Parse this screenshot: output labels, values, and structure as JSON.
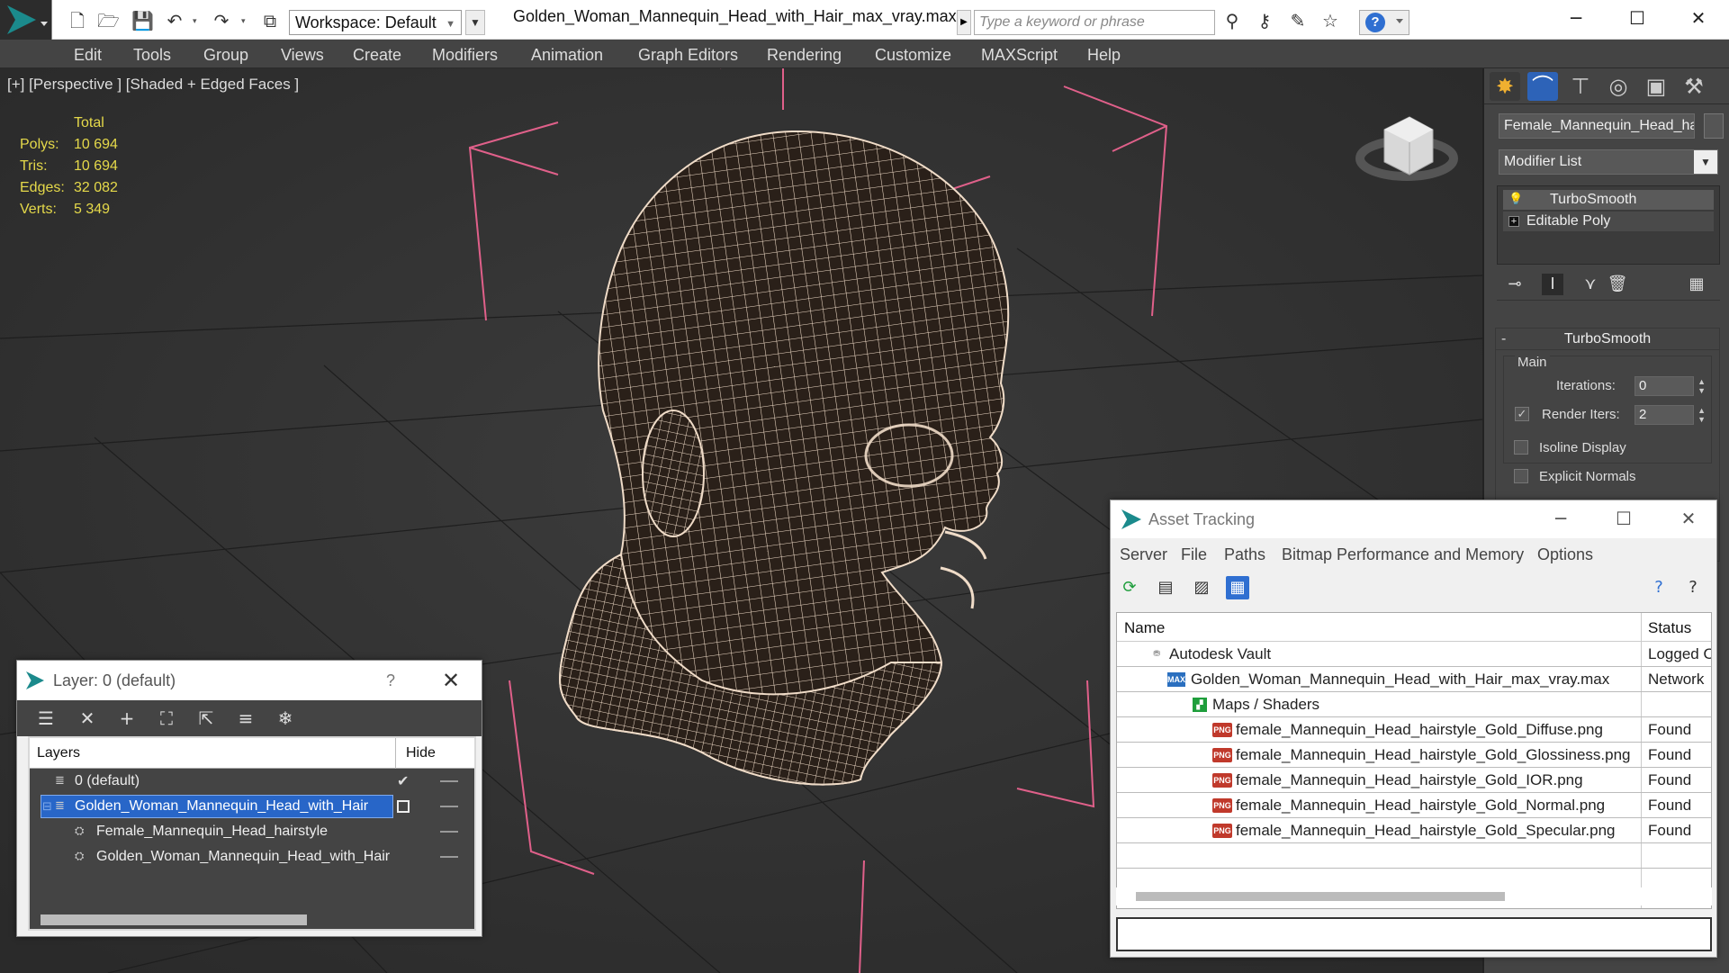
{
  "title_bar": {
    "workspace_label": "Workspace: Default",
    "file_title": "Golden_Woman_Mannequin_Head_with_Hair_max_vray.max",
    "search_placeholder": "Type a keyword or phrase"
  },
  "menu": [
    "Edit",
    "Tools",
    "Group",
    "Views",
    "Create",
    "Modifiers",
    "Animation",
    "Graph Editors",
    "Rendering",
    "Customize",
    "MAXScript",
    "Help"
  ],
  "viewport": {
    "label": "[+] [Perspective ] [Shaded + Edged Faces ]",
    "stats": {
      "header": "Total",
      "rows": [
        {
          "label": "Polys:",
          "value": "10 694"
        },
        {
          "label": "Tris:",
          "value": "10 694"
        },
        {
          "label": "Edges:",
          "value": "32 082"
        },
        {
          "label": "Verts:",
          "value": "5 349"
        }
      ]
    },
    "wire_color": "#f0dcc8",
    "bbox_color": "#e0608a",
    "stats_color": "#e5d94a"
  },
  "command_panel": {
    "object_name": "Female_Mannequin_Head_hairstyle",
    "modifier_list": "Modifier List",
    "stack": [
      "TurboSmooth",
      "Editable Poly"
    ],
    "rollout_title": "TurboSmooth",
    "group_main": "Main",
    "iterations_label": "Iterations:",
    "iterations_value": "0",
    "render_iters_label": "Render Iters:",
    "render_iters_value": "2",
    "render_iters_checked": true,
    "isoline_label": "Isoline Display",
    "explicit_normals_label": "Explicit Normals"
  },
  "layer_dialog": {
    "title": "Layer: 0 (default)",
    "help": "?",
    "col_layers": "Layers",
    "col_hide": "Hide",
    "rows": [
      {
        "name": "0 (default)",
        "level": 0
      },
      {
        "name": "Golden_Woman_Mannequin_Head_with_Hair",
        "level": 0,
        "selected": true
      },
      {
        "name": "Female_Mannequin_Head_hairstyle",
        "level": 1
      },
      {
        "name": "Golden_Woman_Mannequin_Head_with_Hair",
        "level": 1
      }
    ]
  },
  "asset_dialog": {
    "title": "Asset Tracking",
    "menu": [
      "Server",
      "File",
      "Paths",
      "Bitmap Performance and Memory",
      "Options"
    ],
    "col_name": "Name",
    "col_status": "Status",
    "rows": [
      {
        "name": "Autodesk Vault",
        "status": "Logged O",
        "icon": "vault",
        "level": 0
      },
      {
        "name": "Golden_Woman_Mannequin_Head_with_Hair_max_vray.max",
        "status": "Network",
        "icon": "max",
        "level": 1
      },
      {
        "name": "Maps / Shaders",
        "status": "",
        "icon": "map",
        "level": 2
      },
      {
        "name": "female_Mannequin_Head_hairstyle_Gold_Diffuse.png",
        "status": "Found",
        "icon": "png",
        "level": 3
      },
      {
        "name": "female_Mannequin_Head_hairstyle_Gold_Glossiness.png",
        "status": "Found",
        "icon": "png",
        "level": 3
      },
      {
        "name": "female_Mannequin_Head_hairstyle_Gold_IOR.png",
        "status": "Found",
        "icon": "png",
        "level": 3
      },
      {
        "name": "female_Mannequin_Head_hairstyle_Gold_Normal.png",
        "status": "Found",
        "icon": "png",
        "level": 3
      },
      {
        "name": "female_Mannequin_Head_hairstyle_Gold_Specular.png",
        "status": "Found",
        "icon": "png",
        "level": 3
      }
    ]
  }
}
